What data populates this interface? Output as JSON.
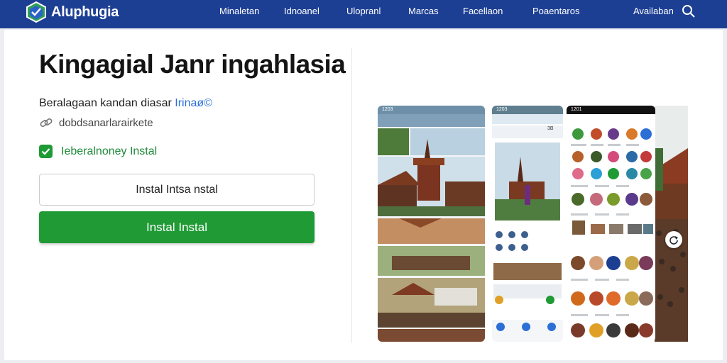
{
  "header": {
    "logo_text": "Aluphugia",
    "nav": [
      "Minaletan",
      "Idnoanel",
      "Ulopranl",
      "Marcas",
      "Facellaon",
      "Poaentaros",
      "Availaban"
    ]
  },
  "hero": {
    "title": "Kingagial Janr ingahlasia",
    "line1_text": "Beralagaan kandan diasar ",
    "line1_highlight": "Irinaø©",
    "line2_text": "dobdsanarlarairkete",
    "line3_text": "Ieberalnoney Instal",
    "install_outline_label": "Instal Intsa nstal",
    "install_green_label": "Instal Instal"
  },
  "gallery": {
    "phone1_status": "1203",
    "phone2_status": "1203",
    "phone3_status": "1201",
    "phone2_badge": "3B"
  },
  "colors": {
    "header_bg": "#1d3f93",
    "primary_green": "#1f9a35",
    "highlight_blue": "#2b6fd6"
  },
  "icons": [
    "logo-icon",
    "search-icon",
    "link-icon",
    "check-icon",
    "refresh-icon"
  ]
}
